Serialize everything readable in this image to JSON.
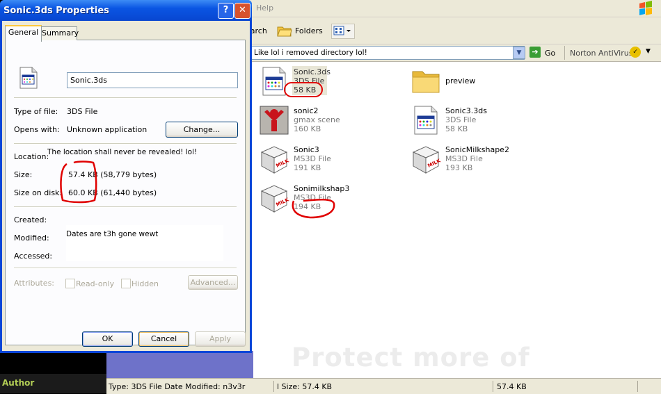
{
  "explorer": {
    "menu_help": "Help",
    "toolbar": {
      "search": "earch",
      "folders": "Folders"
    },
    "address": {
      "value": "Like lol i removed directory lol!",
      "go": "Go",
      "norton": "Norton AntiVirus"
    },
    "files": [
      {
        "name": "Sonic.3ds",
        "type": "3DS File",
        "size": "58 KB",
        "icon": "3ds-file-icon",
        "selected": true
      },
      {
        "name": "preview",
        "type": "",
        "size": "",
        "icon": "folder-icon"
      },
      {
        "name": "sonic2",
        "type": "gmax scene",
        "size": "160 KB",
        "icon": "gmax-icon"
      },
      {
        "name": "Sonic3.3ds",
        "type": "3DS File",
        "size": "58 KB",
        "icon": "3ds-file-icon"
      },
      {
        "name": "Sonic3",
        "type": "MS3D File",
        "size": "191 KB",
        "icon": "milkshape-icon"
      },
      {
        "name": "SonicMilkshape2",
        "type": "MS3D File",
        "size": "193 KB",
        "icon": "milkshape-icon"
      },
      {
        "name": "Sonimilkshap3",
        "type": "MS3D File",
        "size": "194 KB",
        "icon": "milkshape-icon"
      }
    ],
    "watermark": "Protect more of",
    "status": {
      "left": "Type: 3DS File Date Modified: n3v3r",
      "middle": "l Size: 57.4 KB",
      "right": "57.4 KB"
    }
  },
  "sidebar": {
    "author": "Author"
  },
  "dialog": {
    "title": "Sonic.3ds Properties",
    "tabs": [
      "General",
      "Summary"
    ],
    "filename": "Sonic.3ds",
    "type_label": "Type of file:",
    "type_value": "3DS File",
    "opens_label": "Opens with:",
    "opens_value": "Unknown application",
    "change_button": "Change...",
    "location_label": "Location:",
    "location_value": "The location shall never be revealed! lol!",
    "size_label": "Size:",
    "size_value": "57.4 KB (58,779 bytes)",
    "size_on_disk_label": "Size on disk:",
    "size_on_disk_value": "60.0 KB (61,440 bytes)",
    "created_label": "Created:",
    "modified_label": "Modified:",
    "accessed_label": "Accessed:",
    "dates_value": "Dates are t3h gone wewt",
    "attributes_label": "Attributes:",
    "readonly_label": "Read-only",
    "hidden_label": "Hidden",
    "advanced_button": "Advanced...",
    "ok_button": "OK",
    "cancel_button": "Cancel",
    "apply_button": "Apply"
  },
  "colors": {
    "xp_blue": "#0a46d8",
    "annotation_red": "#e00000",
    "author_green": "#b2cd55"
  }
}
